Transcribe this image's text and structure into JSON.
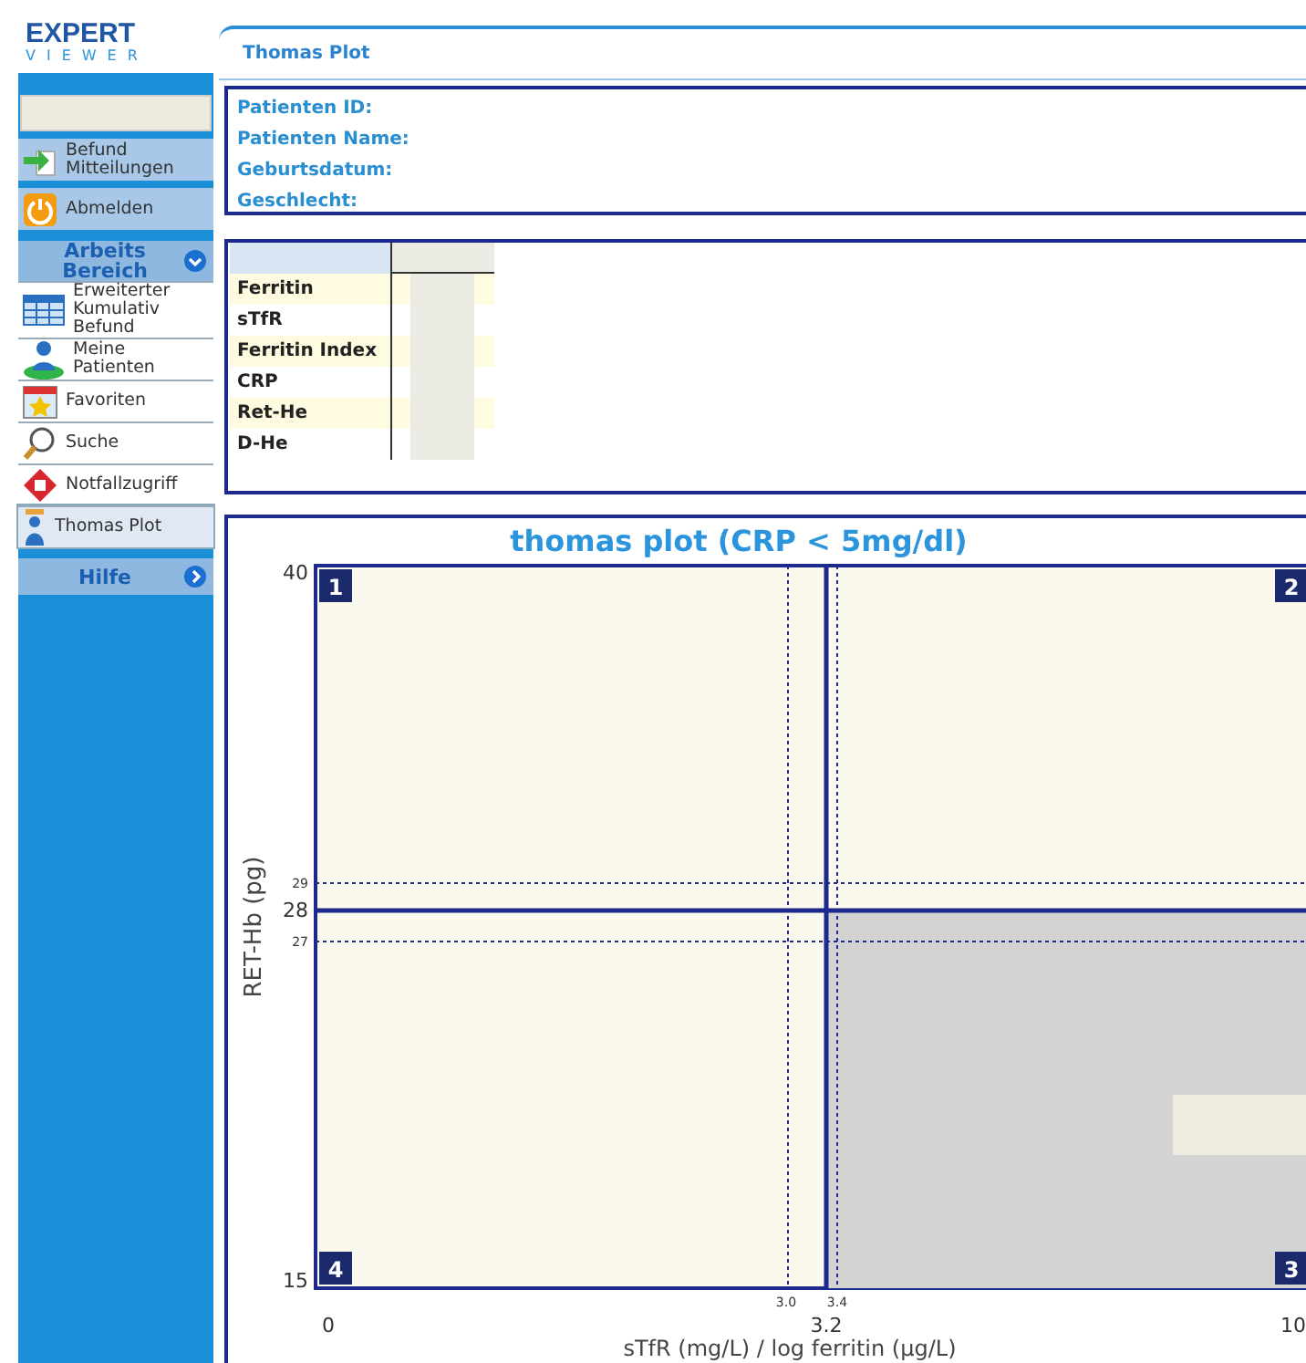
{
  "logo": {
    "line_1": "EXPERT",
    "line_2": "VIEWER"
  },
  "sidebar": {
    "items": [
      {
        "kind": "nav",
        "label": "Befund Mitteilungen",
        "selected": false
      },
      {
        "kind": "nav",
        "label": "Abmelden",
        "selected": false
      },
      {
        "kind": "section",
        "label": "Arbeits Bereich",
        "expanded": true
      },
      {
        "kind": "sub",
        "label": "Erweiterter Kumulativ Befund",
        "selected": false
      },
      {
        "kind": "sub",
        "label": "Meine Patienten",
        "selected": false
      },
      {
        "kind": "sub",
        "label": "Favoriten",
        "selected": false
      },
      {
        "kind": "sub",
        "label": "Suche",
        "selected": false
      },
      {
        "kind": "sub",
        "label": "Notfallzugriff",
        "selected": false
      },
      {
        "kind": "sub",
        "label": "Thomas Plot",
        "selected": true
      },
      {
        "kind": "section",
        "label": "Hilfe",
        "expanded": false
      }
    ]
  },
  "page_title": "Thomas Plot",
  "patient": {
    "fields": [
      "Patienten ID:",
      "Patienten Name:",
      "Geburtsdatum:",
      "Geschlecht:"
    ]
  },
  "results": {
    "rows": [
      "Ferritin",
      "sTfR",
      "Ferritin Index",
      "CRP",
      "Ret-He",
      "D-He"
    ]
  },
  "plot": {
    "title": "thomas plot (CRP < 5mg/dl)",
    "ylabel": "RET-Hb (pg)",
    "xlabel": "sTfR (mg/L) / log ferritin (µg/L)",
    "yticks": [
      "40",
      "29",
      "28",
      "27",
      "15"
    ],
    "xticks": [
      "3.0",
      "3.4",
      "0",
      "3.2",
      "10"
    ],
    "quadrants": [
      "1",
      "2",
      "4",
      "3"
    ]
  }
}
